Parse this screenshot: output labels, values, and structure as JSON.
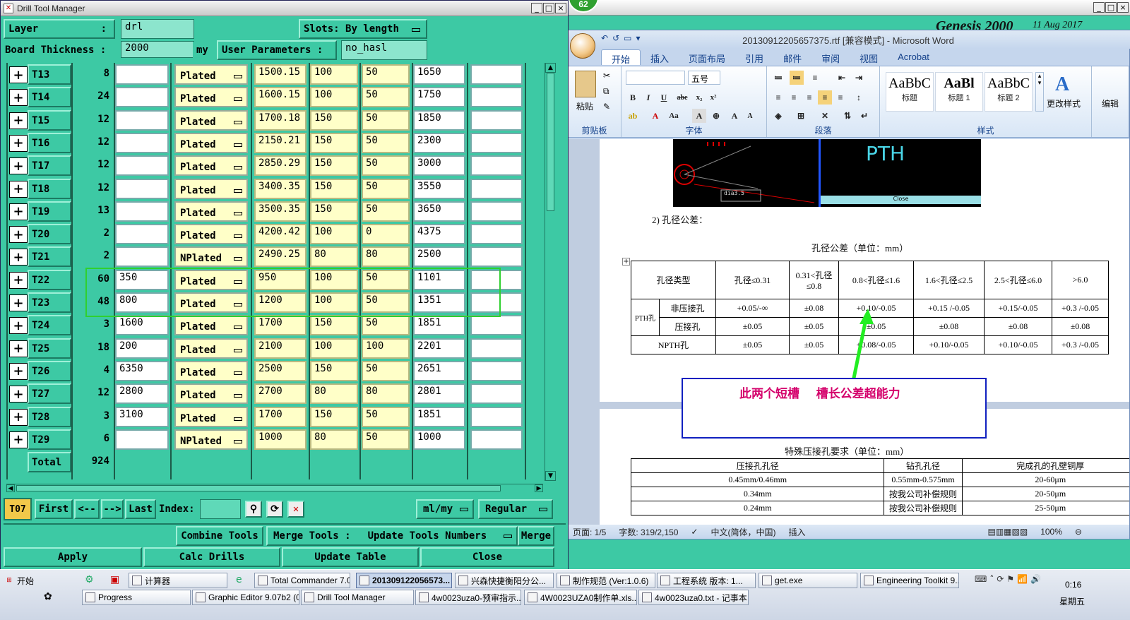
{
  "drill_window": {
    "title": "Drill Tool Manager",
    "layer_label": "Layer",
    "layer_colon": ":",
    "layer_value": "drl",
    "slots_label": "Slots:",
    "slots_value": "By length",
    "board_thickness_label": "Board Thickness :",
    "board_thickness_value": "2000",
    "board_thickness_unit": "my",
    "user_params_label": "User Parameters :",
    "user_params_value": "no_hasl",
    "rows": [
      {
        "tool": "T13",
        "count": "8",
        "size": "",
        "type": "Plated",
        "finish": "1500.15",
        "plus_tol": "100",
        "minus_tol": "50",
        "drill": "1650",
        "extra": ""
      },
      {
        "tool": "T14",
        "count": "24",
        "size": "",
        "type": "Plated",
        "finish": "1600.15",
        "plus_tol": "100",
        "minus_tol": "50",
        "drill": "1750",
        "extra": ""
      },
      {
        "tool": "T15",
        "count": "12",
        "size": "",
        "type": "Plated",
        "finish": "1700.18",
        "plus_tol": "150",
        "minus_tol": "50",
        "drill": "1850",
        "extra": ""
      },
      {
        "tool": "T16",
        "count": "12",
        "size": "",
        "type": "Plated",
        "finish": "2150.21",
        "plus_tol": "150",
        "minus_tol": "50",
        "drill": "2300",
        "extra": ""
      },
      {
        "tool": "T17",
        "count": "12",
        "size": "",
        "type": "Plated",
        "finish": "2850.29",
        "plus_tol": "150",
        "minus_tol": "50",
        "drill": "3000",
        "extra": ""
      },
      {
        "tool": "T18",
        "count": "12",
        "size": "",
        "type": "Plated",
        "finish": "3400.35",
        "plus_tol": "150",
        "minus_tol": "50",
        "drill": "3550",
        "extra": ""
      },
      {
        "tool": "T19",
        "count": "13",
        "size": "",
        "type": "Plated",
        "finish": "3500.35",
        "plus_tol": "150",
        "minus_tol": "50",
        "drill": "3650",
        "extra": ""
      },
      {
        "tool": "T20",
        "count": "2",
        "size": "",
        "type": "Plated",
        "finish": "4200.42",
        "plus_tol": "100",
        "minus_tol": "0",
        "drill": "4375",
        "extra": ""
      },
      {
        "tool": "T21",
        "count": "2",
        "size": "",
        "type": "NPlated",
        "finish": "2490.25",
        "plus_tol": "80",
        "minus_tol": "80",
        "drill": "2500",
        "extra": ""
      },
      {
        "tool": "T22",
        "count": "60",
        "size": "350",
        "type": "Plated",
        "finish": "950",
        "plus_tol": "100",
        "minus_tol": "50",
        "drill": "1101",
        "extra": ""
      },
      {
        "tool": "T23",
        "count": "48",
        "size": "800",
        "type": "Plated",
        "finish": "1200",
        "plus_tol": "100",
        "minus_tol": "50",
        "drill": "1351",
        "extra": ""
      },
      {
        "tool": "T24",
        "count": "3",
        "size": "1600",
        "type": "Plated",
        "finish": "1700",
        "plus_tol": "150",
        "minus_tol": "50",
        "drill": "1851",
        "extra": ""
      },
      {
        "tool": "T25",
        "count": "18",
        "size": "200",
        "type": "Plated",
        "finish": "2100",
        "plus_tol": "100",
        "minus_tol": "100",
        "drill": "2201",
        "extra": ""
      },
      {
        "tool": "T26",
        "count": "4",
        "size": "6350",
        "type": "Plated",
        "finish": "2500",
        "plus_tol": "150",
        "minus_tol": "50",
        "drill": "2651",
        "extra": ""
      },
      {
        "tool": "T27",
        "count": "12",
        "size": "2800",
        "type": "Plated",
        "finish": "2700",
        "plus_tol": "80",
        "minus_tol": "80",
        "drill": "2801",
        "extra": ""
      },
      {
        "tool": "T28",
        "count": "3",
        "size": "3100",
        "type": "Plated",
        "finish": "1700",
        "plus_tol": "150",
        "minus_tol": "50",
        "drill": "1851",
        "extra": ""
      },
      {
        "tool": "T29",
        "count": "6",
        "size": "",
        "type": "NPlated",
        "finish": "1000",
        "plus_tol": "80",
        "minus_tol": "50",
        "drill": "1000",
        "extra": ""
      }
    ],
    "total_label": "Total",
    "total_value": "924",
    "current_tool": "T07",
    "nav": {
      "first": "First",
      "prev": "<--",
      "next": "-->",
      "last": "Last",
      "index_label": "Index:"
    },
    "unit_select": "ml/my",
    "mode_select": "Regular",
    "combine_tools": "Combine Tools",
    "merge_tools_label": "Merge Tools :",
    "update_tools_numbers": "Update Tools Numbers",
    "merge": "Merge",
    "apply": "Apply",
    "calc_drills": "Calc Drills",
    "update_table": "Update Table",
    "close": "Close"
  },
  "genesis": {
    "badge": "62",
    "title_text": "Genesis 2000",
    "date_text": "11 Aug 2017"
  },
  "word": {
    "title": "20130912205657375.rtf [兼容模式] - Microsoft Word",
    "tabs": [
      "开始",
      "插入",
      "页面布局",
      "引用",
      "邮件",
      "审阅",
      "视图",
      "Acrobat"
    ],
    "font_size": "五号",
    "paste": "粘贴",
    "group_labels": [
      "剪贴板",
      "字体",
      "段落",
      "样式"
    ],
    "styles": [
      {
        "sample": "AaBbC",
        "name": "标题"
      },
      {
        "sample": "AaBl",
        "name": "标题 1"
      },
      {
        "sample": "AaBbC",
        "name": "标题 2"
      }
    ],
    "change_styles": "更改样式",
    "edit": "编辑",
    "doc": {
      "pth_label": "PTH",
      "close_label": "Close",
      "diam_label": "dia3.5",
      "section": "2)  孔径公差：",
      "table_title": "孔径公差（单位：mm）",
      "tol_headers": [
        "孔径类型",
        "孔径≤0.31",
        "0.31<孔径≤0.8",
        "0.8<孔径≤1.6",
        "1.6<孔径≤2.5",
        "2.5<孔径≤6.0",
        ">6.0"
      ],
      "pth": "PTH孔",
      "npth": "NPTH孔",
      "row1_label": "非压接孔",
      "row1": [
        "+0.05/-∞",
        "±0.08",
        "+0.10/-0.05",
        "+0.15 /-0.05",
        "+0.15/-0.05",
        "+0.3 /-0.05"
      ],
      "row2_label": "压接孔",
      "row2": [
        "±0.05",
        "±0.05",
        "±0.05",
        "±0.08",
        "±0.08",
        "±0.08"
      ],
      "row3": [
        "±0.05",
        "±0.05",
        "+0.08/-0.05",
        "+0.10/-0.05",
        "+0.10/-0.05",
        "+0.3 /-0.05"
      ],
      "annotation": "此两个短槽    槽长公差超能力",
      "table2_title": "特殊压接孔要求（单位：mm）",
      "t2_headers": [
        "压接孔孔径",
        "钻孔孔径",
        "完成孔的孔壁铜厚"
      ],
      "t2_rows": [
        [
          "0.45mm/0.46mm",
          "0.55mm-0.575mm",
          "20-60μm"
        ],
        [
          "0.34mm",
          "按我公司补偿规则",
          "20-50μm"
        ],
        [
          "0.24mm",
          "按我公司补偿规则",
          "25-50μm"
        ]
      ]
    },
    "status": {
      "page": "页面: 1/5",
      "words": "字数: 319/2,150",
      "lang": "中文(简体，中国)",
      "mode": "插入",
      "zoom": "100%"
    }
  },
  "taskbar": {
    "start": "开始",
    "row1": [
      "计算器",
      "Total Commander 7.0...",
      "201309122056573...",
      "兴森快捷衡阳分公...",
      "制作规范 (Ver:1.0.6)",
      "工程系统  版本: 1...",
      "get.exe",
      "Engineering Toolkit 9...."
    ],
    "row2": [
      "Progress",
      "Graphic Editor 9.07b2 (0...",
      "Drill Tool Manager",
      "4w0023uza0-预审指示....",
      "4W0023UZA0制作单.xls...",
      "4w0023uza0.txt - 记事本"
    ],
    "clock": "0:16",
    "weekday": "星期五"
  },
  "colors": {
    "motif_bg": "#3dc9a4",
    "yellow_cell": "#ffffc8",
    "highlight_box": "#2fd02f",
    "annotation_text": "#d4006b",
    "annotation_border": "#1020c0"
  }
}
